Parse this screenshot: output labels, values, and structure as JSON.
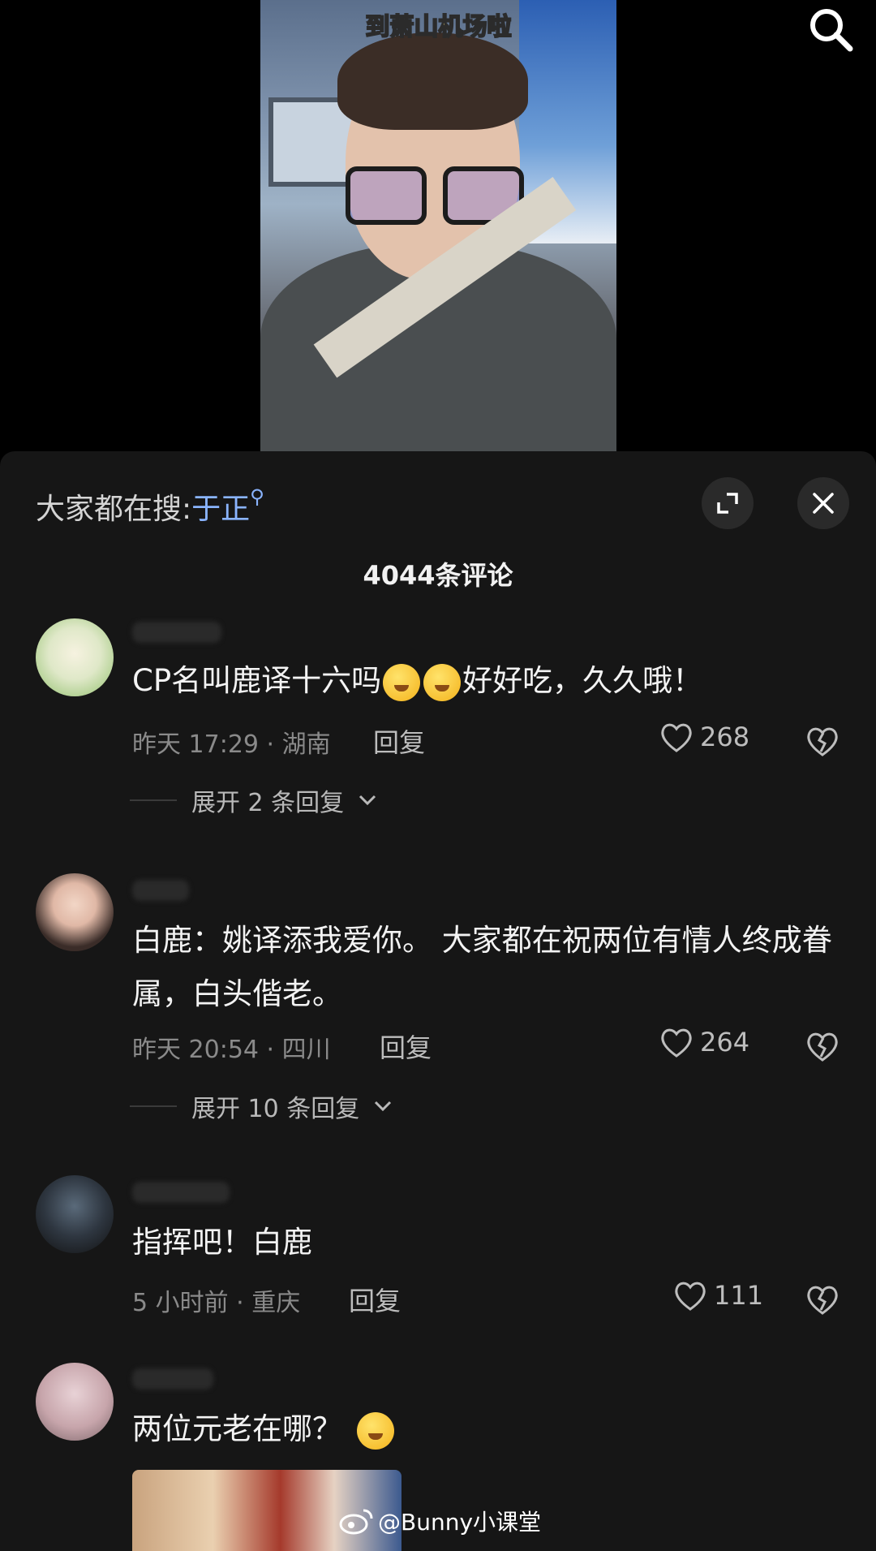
{
  "video": {
    "caption": "到萧山机场啦"
  },
  "sheet": {
    "search_prefix": "大家都在搜:",
    "search_keyword": "于正",
    "comment_count": "4044条评论"
  },
  "comments": [
    {
      "text_before_emoji": "CP名叫鹿译十六吗",
      "text_after_emoji": "好好吃，久久哦！",
      "meta": "昨天 17:29 · 湖南",
      "reply_label": "回复",
      "likes": "268",
      "expand_label": "展开 2 条回复"
    },
    {
      "text": "白鹿：姚译添我爱你。 大家都在祝两位有情人终成眷属，白头偕老。",
      "meta": "昨天 20:54 · 四川",
      "reply_label": "回复",
      "likes": "264",
      "expand_label": "展开 10 条回复"
    },
    {
      "text": "指挥吧！白鹿",
      "meta": "5 小时前 · 重庆",
      "reply_label": "回复",
      "likes": "111"
    },
    {
      "text": "两位元老在哪？"
    }
  ],
  "watermark": {
    "text": "@Bunny小课堂"
  }
}
